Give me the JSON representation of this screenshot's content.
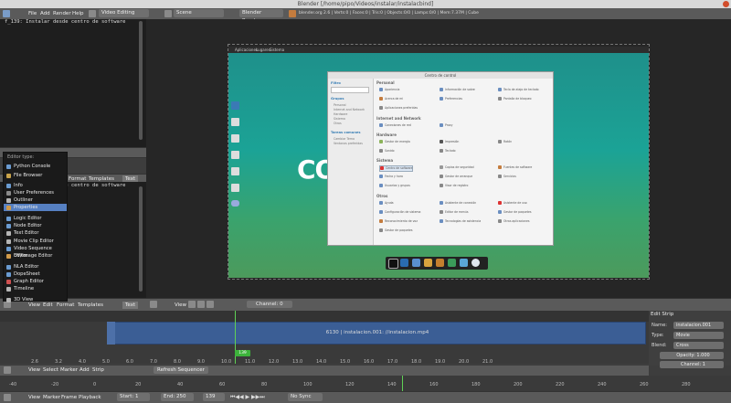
{
  "window": {
    "title": "Blender [/home/pipo/Videos/instalar/instalacbind]"
  },
  "topbar": {
    "menus": [
      "File",
      "Add",
      "Render",
      "Help"
    ],
    "screen_layout": "Video Editing",
    "scene": "Scene",
    "render_engine": "Blender Render",
    "stats": "blender.org 2.6 | Verts:0 | Faces:0 | Tris:0 | Objects:0/0 | Lamps:0/0 | Mem:7.37M | Cube"
  },
  "console_top": {
    "line": "f_139: Instalar desde centro de software"
  },
  "console_mid": {
    "line": "f_139: Instalar desde centro de software"
  },
  "editor_header": {
    "items": [
      "View",
      "Edit",
      "Format",
      "Templates"
    ],
    "text_label": "Text"
  },
  "editor_menu": {
    "heading": "Editor type:",
    "items": [
      {
        "label": "Python Console",
        "color": "#6a9bd1"
      },
      {
        "label": "File Browser",
        "color": "#c9a34a"
      },
      {
        "label": "Info",
        "color": "#6a9bd1"
      },
      {
        "label": "User Preferences",
        "color": "#8a8a8a"
      },
      {
        "label": "Outliner",
        "color": "#b5b5b5"
      },
      {
        "label": "Properties",
        "color": "#d09a4a"
      },
      {
        "label": "Logic Editor",
        "color": "#6a9bd1"
      },
      {
        "label": "Node Editor",
        "color": "#6a9bd1"
      },
      {
        "label": "Text Editor",
        "color": "#b5b5b5"
      },
      {
        "label": "Movie Clip Editor",
        "color": "#b5b5b5"
      },
      {
        "label": "Video Sequence Editor",
        "color": "#6a9bd1"
      },
      {
        "label": "UV/Image Editor",
        "color": "#d09a4a"
      },
      {
        "label": "NLA Editor",
        "color": "#6a9bd1"
      },
      {
        "label": "DopeSheet",
        "color": "#6a9bd1"
      },
      {
        "label": "Graph Editor",
        "color": "#d05050"
      },
      {
        "label": "Timeline",
        "color": "#b5b5b5"
      },
      {
        "label": "3D View",
        "color": "#b5b5b5"
      }
    ]
  },
  "preview_header": {
    "view_label": "View",
    "channel": "Channel: 0"
  },
  "desktop": {
    "panel_items": [
      "Aplicaciones",
      "Lugares",
      "Sistema"
    ],
    "brand_left": "CO",
    "brand_right": "O"
  },
  "control_center": {
    "title": "Centro de control",
    "sidebar": {
      "filter_label": "Filtro",
      "groups_label": "Grupos",
      "groups": [
        "Personal",
        "Internet and Network",
        "Hardware",
        "Sistema",
        "Otros"
      ],
      "tasks_label": "Tareas comunes",
      "tasks": [
        "Cambiar Tema",
        "Ventanas preferidas"
      ]
    },
    "sections": [
      {
        "title": "Personal",
        "items": [
          "Apariencia",
          "Información de sobre",
          "Acerca de mi",
          "Preferencias",
          "Aplicaciones preferidas",
          "Tecla de atajo de teclado",
          "Pantalla de bloqueo"
        ]
      },
      {
        "title": "Internet and Network",
        "items": [
          "Conexiones de red",
          "Proxy"
        ]
      },
      {
        "title": "Hardware",
        "items": [
          "Gestor de energía",
          "Impresión",
          "Ratón",
          "Sonido",
          "Teclado"
        ]
      },
      {
        "title": "Sistema",
        "items": [
          "Centro de software",
          "Copias de seguridad",
          "Fuentes de software",
          "Fecha y hora",
          "Gestor de arranque",
          "Servicios",
          "Usuarios y grupos",
          "Visor de registro"
        ]
      },
      {
        "title": "Otros",
        "items": [
          "Ayuda",
          "Asistente de conexión",
          "Asistente de uso",
          "Configuración de sistema",
          "Editor de menús",
          "Gestor de paquetes",
          "Reconocimiento de voz",
          "Tecnologías de asistencia",
          "Otras aplicaciones"
        ]
      }
    ]
  },
  "sequencer": {
    "strip_label": "6130 | instalacion.001: //instalacion.mp4",
    "frame_badge": "139",
    "ticks": [
      "2.6",
      "3.2",
      "4.0",
      "5.0",
      "6.0",
      "7.0",
      "8.0",
      "9.0",
      "10.0",
      "11.0",
      "12.0",
      "13.0",
      "14.0",
      "15.0",
      "16.0",
      "17.0",
      "18.0",
      "19.0",
      "20.0",
      "21.0"
    ]
  },
  "strip_props": {
    "panel_title": "Edit Strip",
    "name_label": "Name:",
    "name_value": "instalacion.001",
    "type_label": "Type:",
    "type_value": "Movie",
    "blend_label": "Blend:",
    "blend_value": "Cross",
    "opacity": "Opacity: 1.000",
    "channel": "Channel: 1"
  },
  "seq_header": {
    "items": [
      "View",
      "Select",
      "Marker",
      "Add",
      "Strip"
    ],
    "refresh": "Refresh Sequencer"
  },
  "timeline": {
    "ticks": [
      "-40",
      "-20",
      "0",
      "20",
      "40",
      "60",
      "80",
      "100",
      "120",
      "140",
      "160",
      "180",
      "200",
      "220",
      "240",
      "260",
      "280"
    ]
  },
  "bottombar": {
    "items": [
      "View",
      "Marker",
      "Frame",
      "Playback"
    ],
    "start": "Start: 1",
    "end": "End: 250",
    "current": "139",
    "sync": "No Sync"
  }
}
